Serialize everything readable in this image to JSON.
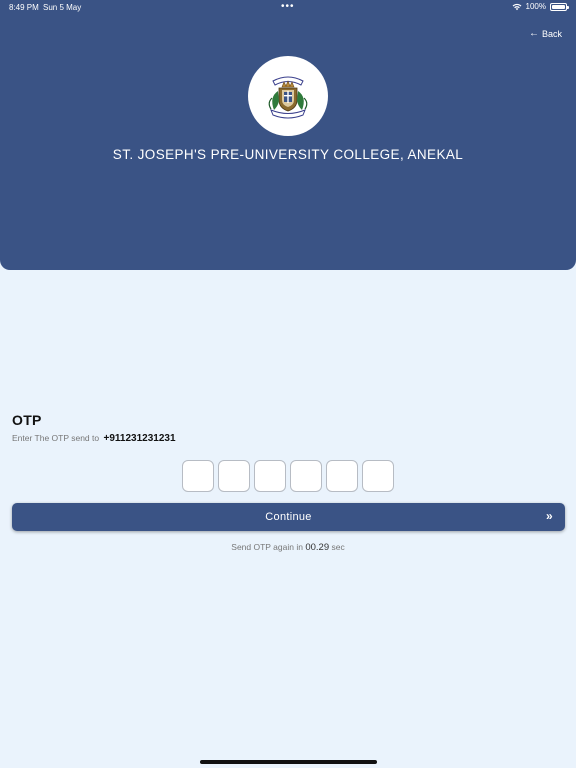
{
  "status_bar": {
    "time": "8:49 PM",
    "date": "Sun 5 May",
    "dots": "•••",
    "battery": "100%"
  },
  "header": {
    "back_label": "Back",
    "college_name": "ST. JOSEPH'S PRE-UNIVERSITY COLLEGE, ANEKAL",
    "logo_icon": "college-crest-icon"
  },
  "otp": {
    "title": "OTP",
    "subtitle": "Enter The OTP send to",
    "phone": "+911231231231",
    "digits": [
      "",
      "",
      "",
      "",
      "",
      ""
    ]
  },
  "continue_button": {
    "label": "Continue",
    "icon": "»"
  },
  "resend": {
    "prefix": "Send OTP again in",
    "timer": "00.29",
    "suffix": "sec"
  },
  "colors": {
    "primary": "#3a5385",
    "background": "#eaf3fc"
  }
}
